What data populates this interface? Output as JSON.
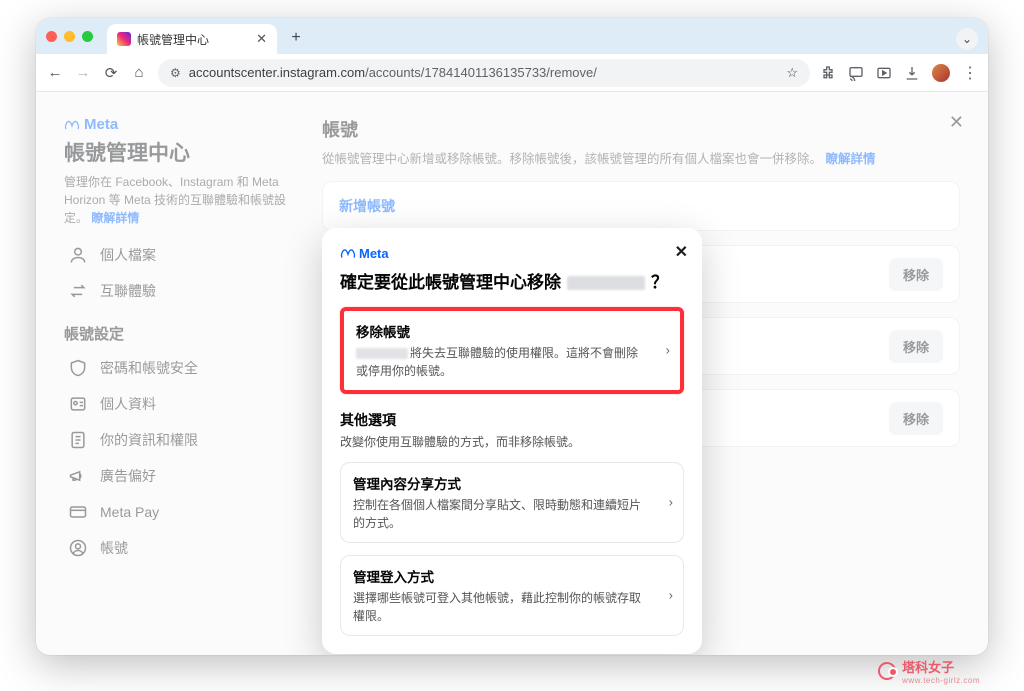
{
  "browser": {
    "tab_title": "帳號管理中心",
    "url_domain": "accountscenter.instagram.com",
    "url_path": "/accounts/17841401136135733/remove/"
  },
  "meta_brand": "Meta",
  "sidebar": {
    "title": "帳號管理中心",
    "desc": "管理你在 Facebook、Instagram 和 Meta Horizon 等 Meta 技術的互聯體驗和帳號設定。",
    "learn_more": "瞭解詳情",
    "items_top": [
      {
        "label": "個人檔案"
      },
      {
        "label": "互聯體驗"
      }
    ],
    "section_label": "帳號設定",
    "items_bottom": [
      {
        "label": "密碼和帳號安全"
      },
      {
        "label": "個人資料"
      },
      {
        "label": "你的資訊和權限"
      },
      {
        "label": "廣告偏好"
      },
      {
        "label": "Meta Pay"
      },
      {
        "label": "帳號"
      }
    ]
  },
  "main": {
    "title": "帳號",
    "desc": "從帳號管理中心新增或移除帳號。移除帳號後，該帳號管理的所有個人檔案也會一併移除。",
    "learn_more": "瞭解詳情",
    "add_account": "新增帳號",
    "remove_label": "移除"
  },
  "modal": {
    "brand": "Meta",
    "title_pre": "確定要從此帳號管理中心移除",
    "title_post": "？",
    "remove": {
      "title": "移除帳號",
      "desc_post": "將失去互聯體驗的使用權限。這將不會刪除或停用你的帳號。"
    },
    "other_title": "其他選項",
    "other_desc": "改變你使用互聯體驗的方式，而非移除帳號。",
    "share": {
      "title": "管理內容分享方式",
      "desc": "控制在各個個人檔案間分享貼文、限時動態和連續短片的方式。"
    },
    "login": {
      "title": "管理登入方式",
      "desc": "選擇哪些帳號可登入其他帳號，藉此控制你的帳號存取權限。"
    }
  },
  "watermark": {
    "name": "塔科女子",
    "sub": "www.tech-girlz.com"
  }
}
